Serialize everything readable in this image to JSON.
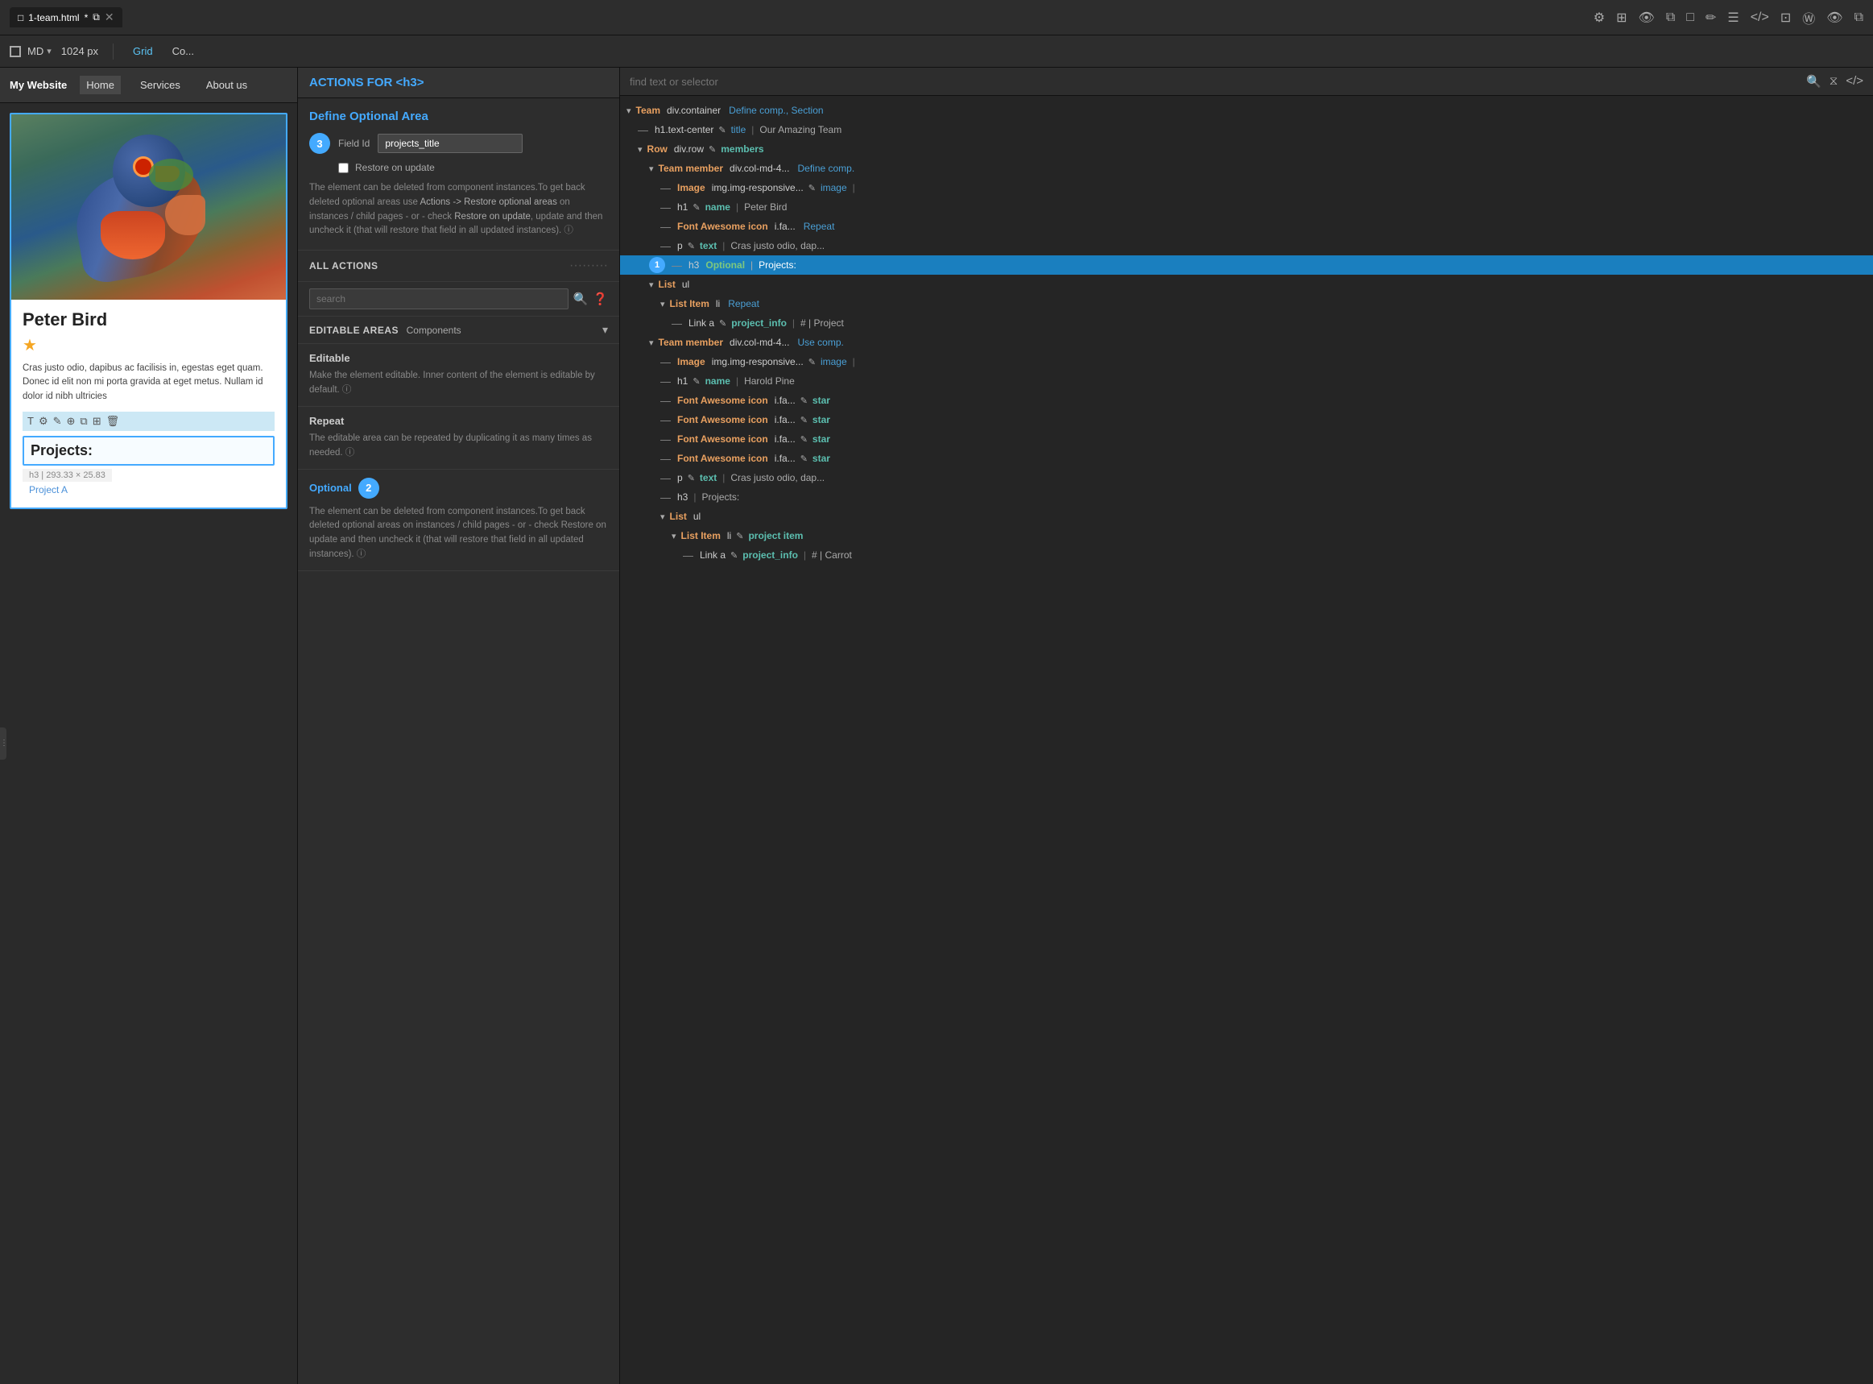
{
  "top_toolbar": {
    "tab_label": "1-team.html",
    "tab_modified": "*",
    "icons": [
      "window-icon",
      "split-icon",
      "close-icon"
    ]
  },
  "second_toolbar": {
    "viewport_label": "MD",
    "px_value": "1024 px",
    "grid_label": "Grid",
    "col_label": "Co..."
  },
  "nav_bar": {
    "brand": "My Website",
    "items": [
      "Home",
      "Services",
      "About us"
    ]
  },
  "card": {
    "name": "Peter Bird",
    "star": "★",
    "text": "Cras justo odio, dapibus ac facilisis in, egestas eget quam. Donec id elit non mi porta gravida at eget metus. Nullam id dolor id nibh ultricies",
    "projects_label": "Projects:",
    "tag": "h3  |  293.33 × 25.83",
    "project_link": "Project A"
  },
  "middle_panel": {
    "actions_header": "ACTIONS FOR <h3>",
    "define_optional_title": "Define Optional Area",
    "step_3": "3",
    "field_id_label": "Field Id",
    "field_id_value": "projects_title",
    "restore_label": "Restore on update",
    "info_text_1": "The element can be deleted from component instances.To get back deleted optional areas use Actions -> Restore optional areas on instances / child pages - or - check Restore on update, update and then uncheck it (that will restore that field in all updated instances).",
    "all_actions_label": "ALL ACTIONS",
    "search_placeholder": "search",
    "editable_areas_label": "EDITABLE AREAS",
    "components_label": "Components",
    "editable_title": "Editable",
    "editable_desc": "Make the element editable. Inner content of the element is editable by default.",
    "repeat_title": "Repeat",
    "repeat_desc": "The editable area can be repeated by duplicating it as many times as needed.",
    "optional_title": "Optional",
    "step_2": "2",
    "optional_desc": "The element can be deleted from component instances.To get back deleted optional areas on instances / child pages - or - check Restore on update and then uncheck it (that will restore that field in all updated instances)."
  },
  "right_panel": {
    "search_placeholder": "find text or selector",
    "tree": [
      {
        "indent": 1,
        "type": "chevron",
        "tag_orange": "Team",
        "tag_white": "div.container",
        "tag_blue": "Define comp., Section",
        "selected": false,
        "badge": null
      },
      {
        "indent": 2,
        "type": "dash",
        "tag_white": "h1.text-center",
        "edit_icon": true,
        "tag_blue": "title",
        "sep": "|",
        "value": "Our Amazing Team",
        "selected": false,
        "badge": null
      },
      {
        "indent": 2,
        "type": "chevron",
        "tag_orange": "Row",
        "tag_white": "div.row",
        "edit_icon": true,
        "tag_teal": "members",
        "selected": false,
        "badge": null
      },
      {
        "indent": 3,
        "type": "chevron",
        "tag_orange": "Team member",
        "tag_white": "div.col-md-4...",
        "tag_blue": "Define comp.",
        "selected": false,
        "badge": null
      },
      {
        "indent": 4,
        "type": "dash",
        "tag_orange": "Image",
        "tag_white": "img.img-responsive...",
        "edit_icon": true,
        "tag_blue": "image",
        "sep": "|",
        "selected": false,
        "badge": null
      },
      {
        "indent": 4,
        "type": "dash",
        "tag_white": "h1",
        "edit_icon": true,
        "tag_teal": "name",
        "sep": "|",
        "value": "Peter Bird",
        "selected": false,
        "badge": null
      },
      {
        "indent": 4,
        "type": "dash",
        "tag_orange": "Font Awesome icon",
        "tag_white": "i.fa...",
        "tag_blue": "Repeat",
        "selected": false,
        "badge": null
      },
      {
        "indent": 4,
        "type": "dash",
        "tag_white": "p",
        "edit_icon": true,
        "tag_teal": "text",
        "sep": "|",
        "value": "Cras justo odio, dap...",
        "selected": false,
        "badge": null
      },
      {
        "indent": 3,
        "type": "dash",
        "tag_white": "h3",
        "tag_green": "Optional",
        "sep": "|",
        "value": "Projects:",
        "selected": true,
        "badge": "1"
      },
      {
        "indent": 3,
        "type": "chevron",
        "tag_orange": "List",
        "tag_white": "ul",
        "selected": false,
        "badge": null
      },
      {
        "indent": 4,
        "type": "chevron",
        "tag_orange": "List Item",
        "tag_white": "li",
        "tag_blue": "Repeat",
        "selected": false,
        "badge": null
      },
      {
        "indent": 5,
        "type": "dash",
        "tag_white": "Link a",
        "edit_icon": true,
        "tag_teal": "project_info",
        "sep": "|",
        "value": "# | Project",
        "selected": false,
        "badge": null
      },
      {
        "indent": 3,
        "type": "chevron",
        "tag_orange": "Team member",
        "tag_white": "div.col-md-4...",
        "tag_blue": "Use comp.",
        "selected": false,
        "badge": null
      },
      {
        "indent": 4,
        "type": "dash",
        "tag_orange": "Image",
        "tag_white": "img.img-responsive...",
        "edit_icon": true,
        "tag_blue": "image",
        "sep": "|",
        "selected": false,
        "badge": null
      },
      {
        "indent": 4,
        "type": "dash",
        "tag_white": "h1",
        "edit_icon": true,
        "tag_teal": "name",
        "sep": "|",
        "value": "Harold Pine",
        "selected": false,
        "badge": null
      },
      {
        "indent": 4,
        "type": "dash",
        "tag_orange": "Font Awesome icon",
        "tag_white": "i.fa...",
        "edit_icon": true,
        "tag_teal": "star",
        "selected": false,
        "badge": null
      },
      {
        "indent": 4,
        "type": "dash",
        "tag_orange": "Font Awesome icon",
        "tag_white": "i.fa...",
        "edit_icon": true,
        "tag_teal": "star",
        "selected": false,
        "badge": null,
        "idx": 2
      },
      {
        "indent": 4,
        "type": "dash",
        "tag_orange": "Font Awesome icon",
        "tag_white": "i.fa...",
        "edit_icon": true,
        "tag_teal": "star",
        "selected": false,
        "badge": null,
        "idx": 3
      },
      {
        "indent": 4,
        "type": "dash",
        "tag_orange": "Font Awesome icon",
        "tag_white": "i.fa...",
        "edit_icon": true,
        "tag_teal": "star",
        "selected": false,
        "badge": null,
        "idx": 4
      },
      {
        "indent": 4,
        "type": "dash",
        "tag_white": "p",
        "edit_icon": true,
        "tag_teal": "text",
        "sep": "|",
        "value": "Cras justo odio, dap...",
        "selected": false,
        "badge": null
      },
      {
        "indent": 4,
        "type": "dash",
        "tag_white": "h3",
        "sep": "|",
        "value": "Projects:",
        "selected": false,
        "badge": null
      },
      {
        "indent": 4,
        "type": "chevron",
        "tag_orange": "List",
        "tag_white": "ul",
        "selected": false,
        "badge": null
      },
      {
        "indent": 5,
        "type": "chevron",
        "tag_orange": "List Item",
        "tag_white": "li",
        "edit_icon": true,
        "tag_teal": "project item",
        "selected": false,
        "badge": null
      },
      {
        "indent": 6,
        "type": "dash",
        "tag_white": "Link a",
        "edit_icon": true,
        "tag_teal": "project_info",
        "sep": "|",
        "value": "# | Carrot",
        "selected": false,
        "badge": null
      }
    ]
  }
}
